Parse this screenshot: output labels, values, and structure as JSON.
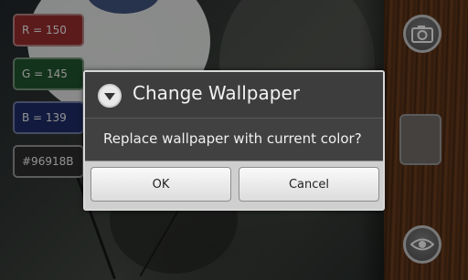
{
  "readouts": {
    "red": "R = 150",
    "green": "G = 145",
    "blue": "B = 139",
    "hex": "#96918B"
  },
  "current_color": "#96918B",
  "side_panel": {
    "camera_icon": "camera-icon",
    "eye_icon": "eye-icon"
  },
  "dialog": {
    "icon": "dropdown-circle-icon",
    "title": "Change Wallpaper",
    "message": "Replace wallpaper with current color?",
    "ok_label": "OK",
    "cancel_label": "Cancel"
  }
}
